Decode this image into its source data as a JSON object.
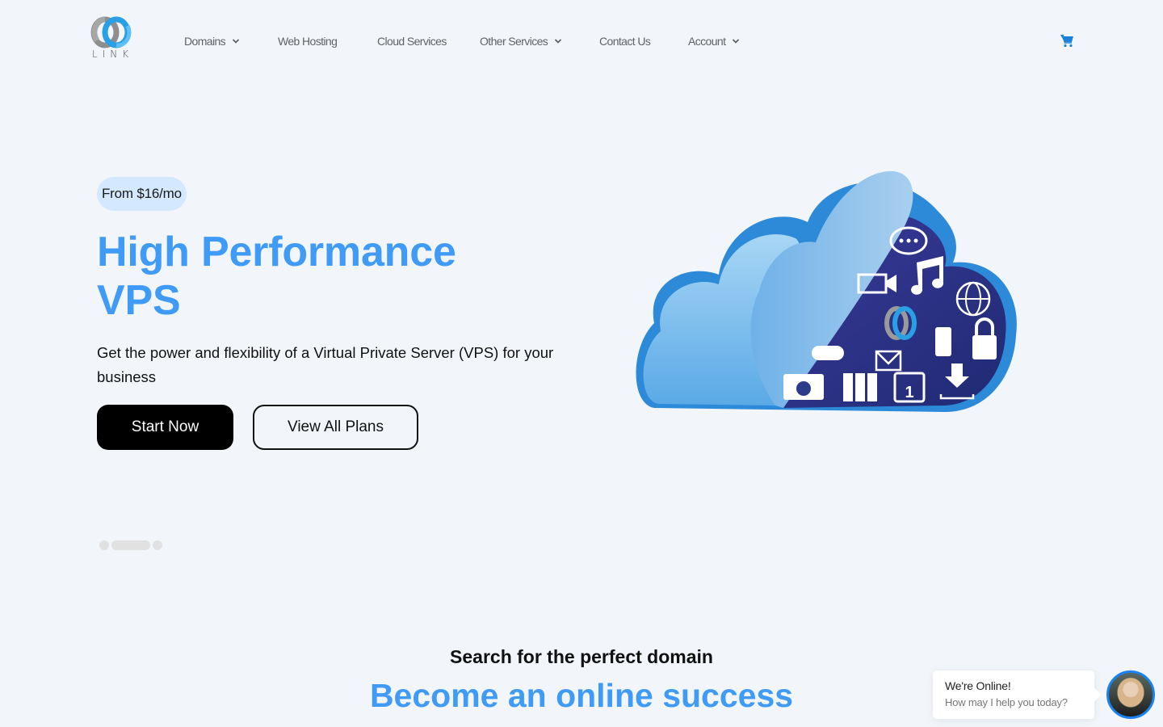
{
  "brand": {
    "logo_text": "LINK",
    "logo_icon": "interlocking-rings-logo"
  },
  "nav": {
    "items": [
      {
        "label": "Domains",
        "has_dropdown": true
      },
      {
        "label": "Web Hosting",
        "has_dropdown": false
      },
      {
        "label": "Cloud Services",
        "has_dropdown": false
      },
      {
        "label": "Other Services",
        "has_dropdown": true
      },
      {
        "label": "Contact Us",
        "has_dropdown": false
      },
      {
        "label": "Account",
        "has_dropdown": true
      }
    ],
    "cart_icon": "shopping-cart-icon"
  },
  "hero": {
    "price_badge": "From $16/mo",
    "title_line1": "High Performance",
    "title_line2": "VPS",
    "description": "Get the power and flexibility of a Virtual Private Server (VPS) for your business",
    "primary_button": "Start Now",
    "secondary_button": "View All Plans",
    "image": "cloud-services-illustration",
    "slider": {
      "total_slides": 3,
      "active_index": 1
    }
  },
  "domain_section": {
    "subtitle": "Search for the perfect domain",
    "title": "Become an online success"
  },
  "chat_widget": {
    "title": "We're Online!",
    "message": "How may I help you today?",
    "avatar": "support-agent-avatar"
  },
  "colors": {
    "accent": "#3f9bf5",
    "background": "#f2f6fa",
    "badge_bg": "#d4e8ff",
    "cart": "#1a82d8",
    "chat_ring": "#1a82f0"
  }
}
